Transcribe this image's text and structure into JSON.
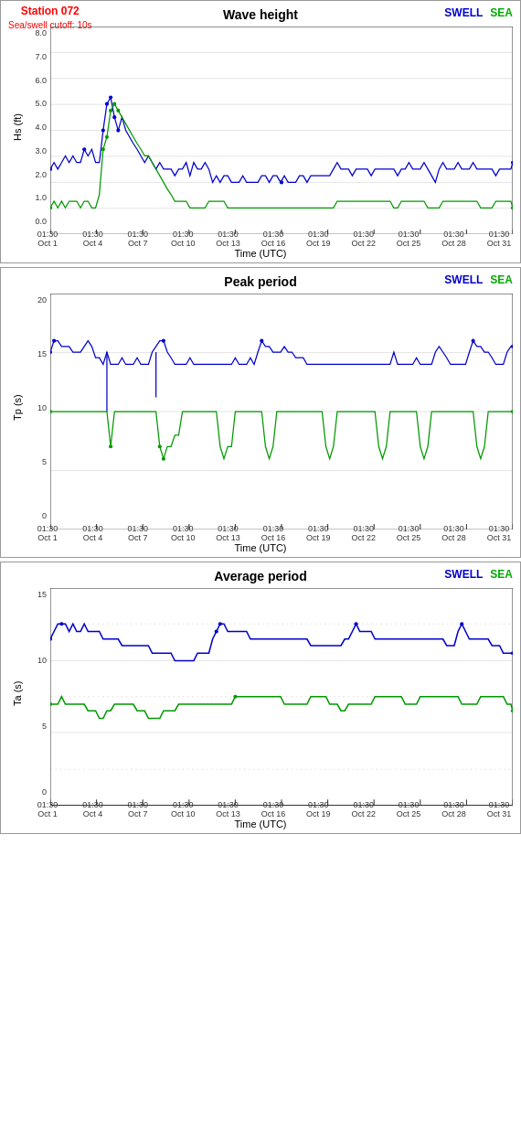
{
  "station": {
    "id": "Station 072",
    "cutoff": "Sea/swell cutoff: 10s"
  },
  "chart1": {
    "title": "Wave height",
    "yLabel": "Hs (ft)",
    "xTitle": "Time (UTC)",
    "yTicks": [
      "0.0",
      "1.0",
      "2.0",
      "3.0",
      "4.0",
      "5.0",
      "6.0",
      "7.0",
      "8.0"
    ],
    "xLabels": [
      {
        "line1": "01:30",
        "line2": "Oct 1"
      },
      {
        "line1": "01:30",
        "line2": "Oct 4"
      },
      {
        "line1": "01:30",
        "line2": "Oct 7"
      },
      {
        "line1": "01:30",
        "line2": "Oct 10"
      },
      {
        "line1": "01:30",
        "line2": "Oct 13"
      },
      {
        "line1": "01:30",
        "line2": "Oct 16"
      },
      {
        "line1": "01:30",
        "line2": "Oct 19"
      },
      {
        "line1": "01:30",
        "line2": "Oct 22"
      },
      {
        "line1": "01:30",
        "line2": "Oct 25"
      },
      {
        "line1": "01:30",
        "line2": "Oct 28"
      },
      {
        "line1": "01:30",
        "line2": "Oct 31"
      }
    ]
  },
  "chart2": {
    "title": "Peak period",
    "yLabel": "Tp (s)",
    "xTitle": "Time (UTC)",
    "yTicks": [
      "0",
      "5",
      "10",
      "15",
      "20"
    ],
    "xLabels": [
      {
        "line1": "01:30",
        "line2": "Oct 1"
      },
      {
        "line1": "01:30",
        "line2": "Oct 4"
      },
      {
        "line1": "01:30",
        "line2": "Oct 7"
      },
      {
        "line1": "01:30",
        "line2": "Oct 10"
      },
      {
        "line1": "01:30",
        "line2": "Oct 13"
      },
      {
        "line1": "01:30",
        "line2": "Oct 16"
      },
      {
        "line1": "01:30",
        "line2": "Oct 19"
      },
      {
        "line1": "01:30",
        "line2": "Oct 22"
      },
      {
        "line1": "01:30",
        "line2": "Oct 25"
      },
      {
        "line1": "01:30",
        "line2": "Oct 28"
      },
      {
        "line1": "01:30",
        "line2": "Oct 31"
      }
    ]
  },
  "chart3": {
    "title": "Average period",
    "yLabel": "Ta (s)",
    "xTitle": "Time (UTC)",
    "yTicks": [
      "0",
      "5",
      "10",
      "15"
    ],
    "xLabels": [
      {
        "line1": "01:30",
        "line2": "Oct 1"
      },
      {
        "line1": "01:30",
        "line2": "Oct 4"
      },
      {
        "line1": "01:30",
        "line2": "Oct 7"
      },
      {
        "line1": "01:30",
        "line2": "Oct 10"
      },
      {
        "line1": "01:30",
        "line2": "Oct 13"
      },
      {
        "line1": "01:30",
        "line2": "Oct 16"
      },
      {
        "line1": "01:30",
        "line2": "Oct 19"
      },
      {
        "line1": "01:30",
        "line2": "Oct 22"
      },
      {
        "line1": "01:30",
        "line2": "Oct 25"
      },
      {
        "line1": "01:30",
        "line2": "Oct 28"
      },
      {
        "line1": "01:30",
        "line2": "Oct 31"
      }
    ]
  },
  "legend": {
    "swell": "SWELL",
    "sea": "SEA"
  }
}
